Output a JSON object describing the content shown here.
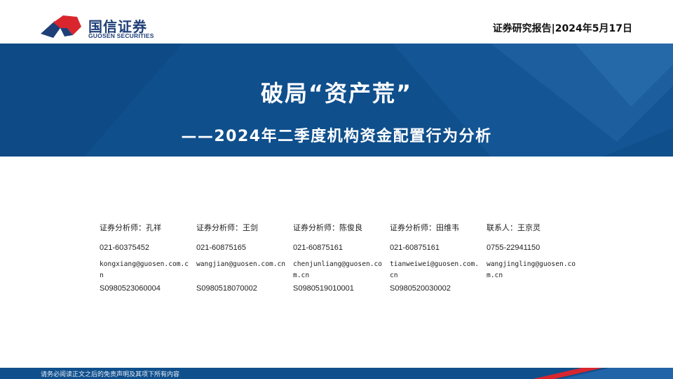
{
  "header": {
    "logo_cn": "国信证券",
    "logo_en": "GUOSEN SECURITIES",
    "report_tag": "证券研究报告|2024年5月17日"
  },
  "banner": {
    "title": "破局“资产荒”",
    "subtitle": "——2024年二季度机构资金配置行为分析"
  },
  "analysts": [
    {
      "role": "证券分析师：孔祥",
      "phone": "021-60375452",
      "email": "kongxiang@guosen.com.cn",
      "cert": "S0980523060004"
    },
    {
      "role": "证券分析师：王剑",
      "phone": "021-60875165",
      "email": "wangjian@guosen.com.cn",
      "cert": "S0980518070002"
    },
    {
      "role": "证券分析师：陈俊良",
      "phone": "021-60875161",
      "email": "chenjunliang@guosen.com.cn",
      "cert": "S0980519010001"
    },
    {
      "role": "证券分析师：田维韦",
      "phone": "021-60875161",
      "email": "tianweiwei@guosen.com.cn",
      "cert": "S0980520030002"
    },
    {
      "role": "联系人：王京灵",
      "phone": "0755-22941150",
      "email": "wangjingling@guosen.com.cn",
      "cert": ""
    }
  ],
  "footer": {
    "disclaimer": "请务必阅读正文之后的免责声明及其项下所有内容"
  },
  "colors": {
    "brand_blue": "#0f4f8c",
    "logo_blue": "#1f3f78",
    "accent_red": "#d9262e"
  }
}
